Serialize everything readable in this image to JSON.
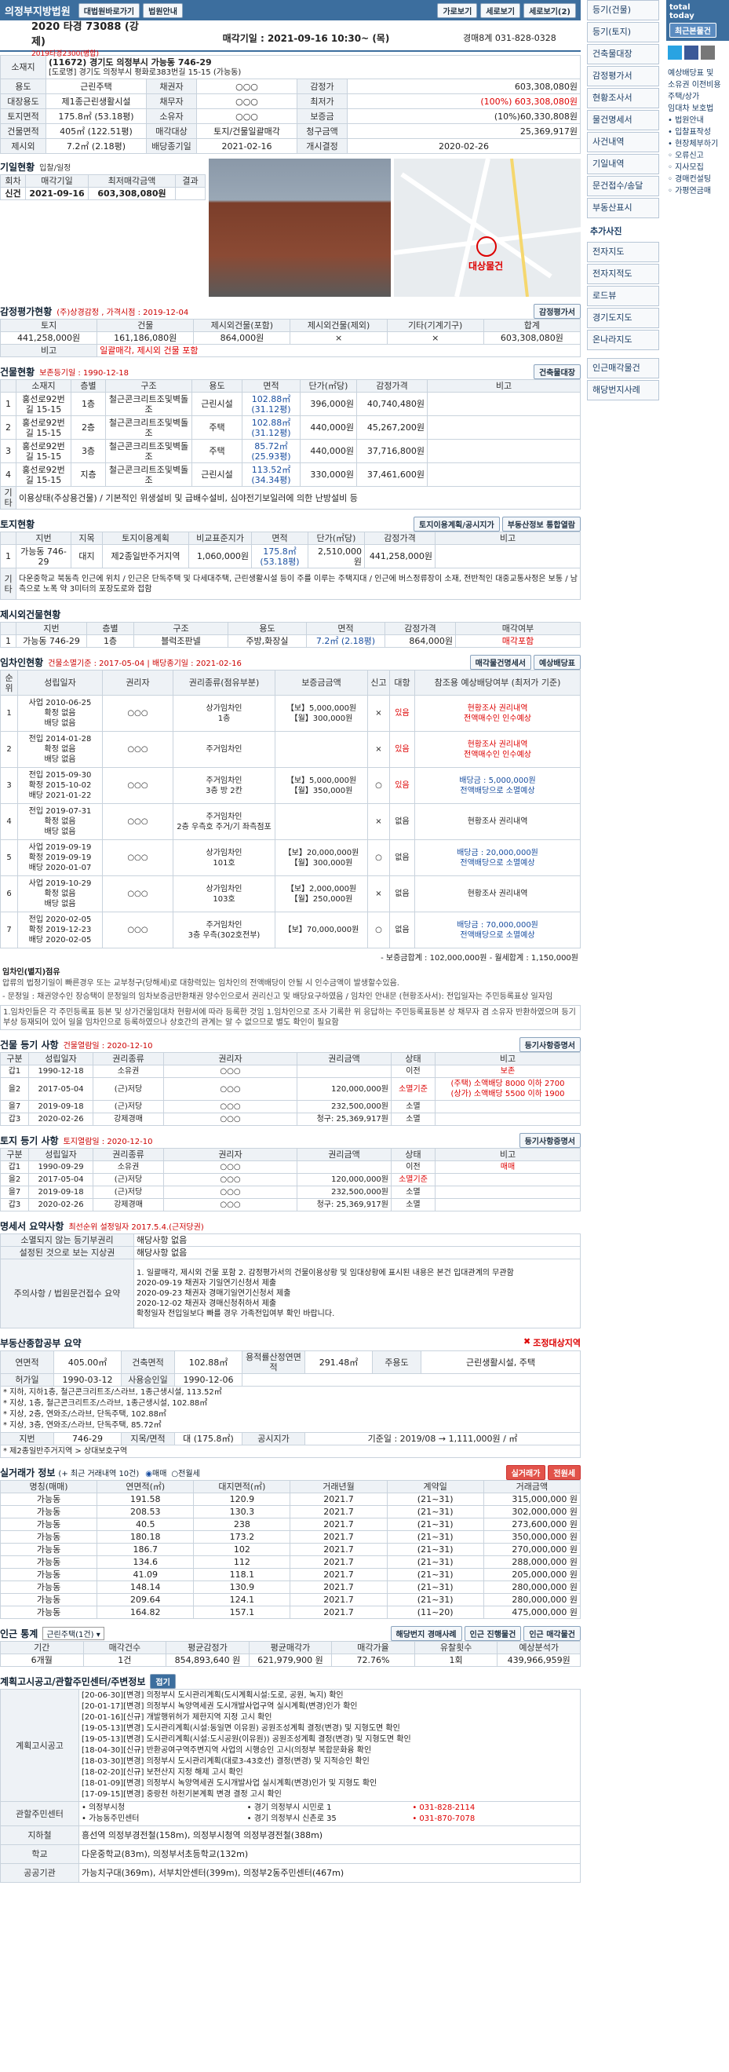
{
  "court": {
    "name": "의정부지방법원",
    "court_btn1": "대법원바로가기",
    "court_btn2": "법원안내"
  },
  "topbtns": [
    "가로보기",
    "세로보기",
    "세로보기(2)"
  ],
  "case": {
    "no": "2020 타경 73088 (강제)",
    "sub": "2019타경2300(병합)",
    "sale_date_label": "매각기일 : 2021-09-16 10:30~ (목)",
    "team": "경매8계 031-828-0328"
  },
  "info": {
    "addr_label": "소재지",
    "addr": "(11672) 경기도 의정부시 가능동 746-29",
    "addr2": "[도로명]  경기도 의정부시 평화로383번길 15-15 (가능동)",
    "rows": [
      [
        "용도",
        "근린주택",
        "채권자",
        "○○○",
        "감정가",
        "603,308,080원"
      ],
      [
        "대장용도",
        "제1종근린생활시설",
        "채무자",
        "○○○",
        "최저가",
        "(100%) 603,308,080원"
      ],
      [
        "토지면적",
        "175.8㎡ (53.18평)",
        "소유자",
        "○○○",
        "보증금",
        "(10%)60,330,808원"
      ],
      [
        "건물면적",
        "405㎡ (122.51평)",
        "매각대상",
        "토지/건물일괄매각",
        "청구금액",
        "25,369,917원"
      ],
      [
        "제시외",
        "7.2㎡ (2.18평)",
        "배당종기일",
        "2021-02-16",
        "개시결정",
        "2020-02-26"
      ]
    ]
  },
  "history": {
    "title": "기일현황",
    "sub": "입찰/일정",
    "h": [
      "회차",
      "매각기일",
      "최저매각금액",
      "결과"
    ],
    "rows": [
      [
        "신건",
        "2021-09-16",
        "603,308,080원",
        ""
      ]
    ]
  },
  "map": {
    "label": "대상물건"
  },
  "appraisal": {
    "title": "감정평가현황",
    "sub": "(주)상경감정 , 가격시점 : 2019-12-04",
    "btn": "감정평가서",
    "h": [
      "토지",
      "건물",
      "제시외건물(포함)",
      "제시외건물(제외)",
      "기타(기계기구)",
      "합계"
    ],
    "row": [
      "441,258,000원",
      "161,186,080원",
      "864,000원",
      "×",
      "×",
      "603,308,080원"
    ],
    "note_label": "비고",
    "note": "일괄매각, 제시외 건물 포함"
  },
  "building": {
    "title": "건물현황",
    "sub": "보존등기일 : 1990-12-18",
    "btn": "건축물대장",
    "h": [
      "소재지",
      "층별",
      "구조",
      "용도",
      "면적",
      "단가(㎡당)",
      "감정가격",
      "비고"
    ],
    "rows": [
      [
        "1",
        "홍선로92번길 15-15",
        "1층",
        "철근콘크리트조및벽돌조",
        "근린시설",
        "102.88㎡ (31.12평)",
        "396,000원",
        "40,740,480원",
        ""
      ],
      [
        "2",
        "홍선로92번길 15-15",
        "2층",
        "철근콘크리트조및벽돌조",
        "주택",
        "102.88㎡ (31.12평)",
        "440,000원",
        "45,267,200원",
        ""
      ],
      [
        "3",
        "홍선로92번길 15-15",
        "3층",
        "철근콘크리트조및벽돌조",
        "주택",
        "85.72㎡ (25.93평)",
        "440,000원",
        "37,716,800원",
        ""
      ],
      [
        "4",
        "홍선로92번길 15-15",
        "지층",
        "철근콘크리트조및벽돌조",
        "근린시설",
        "113.52㎡ (34.34평)",
        "330,000원",
        "37,461,600원",
        ""
      ]
    ],
    "etc_label": "기타",
    "etc": "이용상태(주상용건물) / 기본적인 위생설비 및 급배수설비, 심야전기보일러에 의한 난방설비 등"
  },
  "land": {
    "title": "토지현황",
    "btn1": "토지이용계획/공시지가",
    "btn2": "부동산정보 통합열람",
    "h": [
      "지번",
      "지목",
      "토지이용계획",
      "비교표준지가",
      "면적",
      "단가(㎡당)",
      "감정가격",
      "비고"
    ],
    "row": [
      "1",
      "가능동 746-29",
      "대지",
      "제2종일반주거지역",
      "1,060,000원",
      "175.8㎡ (53.18평)",
      "2,510,000원",
      "441,258,000원",
      ""
    ],
    "etc_label": "기타",
    "etc": "다운중학교 북동측 인근에 위치 / 인근은 단독주택 및 다세대주택, 근린생활시설 등이 주를 이루는 주택지대 / 인근에 버스정류장이 소재, 전반적인 대중교통사정은 보통 / 남측으로 노폭 약 3미터의 포장도로와 접함"
  },
  "extra": {
    "title": "제시외건물현황",
    "h": [
      "지번",
      "층별",
      "구조",
      "용도",
      "면적",
      "감정가격",
      "매각여부"
    ],
    "row": [
      "1",
      "가능동 746-29",
      "1층",
      "블럭조판넬",
      "주방,화장실",
      "7.2㎡ (2.18평)",
      "864,000원",
      "매각포함"
    ]
  },
  "lease": {
    "title": "임차인현황",
    "sub": "건물소멸기준 : 2017-05-04 | 배당종기일 : 2021-02-16",
    "btn1": "매각물건명세서",
    "btn2": "예상배당표",
    "h": [
      "순위",
      "성립일자",
      "권리자",
      "권리종류(점유부분)",
      "보증금금액",
      "신고",
      "대항",
      "참조용 예상배당여부 (최저가 기준)"
    ],
    "rows": [
      [
        "1",
        "사업 2010-06-25\n확정 없음\n배당 없음",
        "○○○",
        "상가임차인\n1층",
        "【보】5,000,000원\n【월】300,000원",
        "×",
        "있음",
        "현황조사 권리내역\n전액매수인 인수예상"
      ],
      [
        "2",
        "전입 2014-01-28\n확정 없음\n배당 없음",
        "○○○",
        "주거임차인",
        "",
        "×",
        "있음",
        "현황조사 권리내역\n전액매수인 인수예상"
      ],
      [
        "3",
        "전입 2015-09-30\n확정 2015-10-02\n배당 2021-01-22",
        "○○○",
        "주거임차인\n3층 방 2칸",
        "【보】5,000,000원\n【월】350,000원",
        "○",
        "있음",
        "배당금 : 5,000,000원\n전액배당으로 소멸예상"
      ],
      [
        "4",
        "전입 2019-07-31\n확정 없음\n배당 없음",
        "○○○",
        "주거임차인\n2층 우측호 주거/기 좌측점포",
        "",
        "×",
        "없음",
        "현황조사 권리내역"
      ],
      [
        "5",
        "사업 2019-09-19\n확정 2019-09-19\n배당 2020-01-07",
        "○○○",
        "상가임차인\n101호",
        "【보】20,000,000원\n【월】300,000원",
        "○",
        "없음",
        "배당금 : 20,000,000원\n전액배당으로 소멸예상"
      ],
      [
        "6",
        "사업 2019-10-29\n확정 없음\n배당 없음",
        "○○○",
        "상가임차인\n103호",
        "【보】2,000,000원\n【월】250,000원",
        "×",
        "없음",
        "현황조사 권리내역"
      ],
      [
        "7",
        "전입 2020-02-05\n확정 2019-12-23\n배당 2020-02-05",
        "○○○",
        "주거임차인\n3층 우측(302호전부)",
        "【보】70,000,000원",
        "○",
        "없음",
        "배당금 : 70,000,000원\n전액배당으로 소멸예상"
      ]
    ],
    "sum": "- 보증금합계 : 102,000,000원 - 월세합계 : 1,150,000원",
    "flag": "임차인(별지)점유",
    "note1": "압류의 법정기일이 빠른경우 또는 교부청구(당해세)로 대항력있는 임차인의 전액배당이 안될 시 인수금액이 발생할수있음.",
    "note2": "- 문정일 : 채권양수인 장승택이 문정일의 임차보증금반환채권 양수인으로서 권리신고 및 배당요구하였음 / 임차인 안내문 (현황조사서): 전입일자는 주민등록표상 일자임",
    "note3": "1.임차인들은 각 주민등록표 등본 및 상가건물임대차 현황서에 따라 등록한 것임 1.임차인으로 조사 기록한 위 응답하는 주민등록표등본 상 채무자 겸 소유자 반환하였으며 등기부상 등재되어 있어 일을 임차인으로 등록하였으나 상호간의 관계는 알 수 없으므로 별도 확인이 필요함"
  },
  "breg": {
    "title": "건물 등기 사항",
    "sub": "건물열람일 : 2020-12-10",
    "btn": "등기사항증명서",
    "h": [
      "구분",
      "성립일자",
      "권리종류",
      "권리자",
      "권리금액",
      "상태",
      "비고"
    ],
    "rows": [
      [
        "갑1",
        "1990-12-18",
        "소유권",
        "○○○",
        "",
        "이전",
        "보존"
      ],
      [
        "을2",
        "2017-05-04",
        "(근)저당",
        "○○○",
        "120,000,000원",
        "소멸기준",
        "(주택) 소액배당 8000 이하 2700\n(상가) 소액배당 5500 이하 1900"
      ],
      [
        "을7",
        "2019-09-18",
        "(근)저당",
        "○○○",
        "232,500,000원",
        "소멸",
        ""
      ],
      [
        "갑3",
        "2020-02-26",
        "강제경매",
        "○○○",
        "청구: 25,369,917원",
        "소멸",
        ""
      ]
    ]
  },
  "lreg": {
    "title": "토지 등기 사항",
    "sub": "토지열람일 : 2020-12-10",
    "btn": "등기사항증명서",
    "h": [
      "구분",
      "성립일자",
      "권리종류",
      "권리자",
      "권리금액",
      "상태",
      "비고"
    ],
    "rows": [
      [
        "갑1",
        "1990-09-29",
        "소유권",
        "○○○",
        "",
        "이전",
        "매매"
      ],
      [
        "을2",
        "2017-05-04",
        "(근)저당",
        "○○○",
        "120,000,000원",
        "소멸기준",
        ""
      ],
      [
        "을7",
        "2019-09-18",
        "(근)저당",
        "○○○",
        "232,500,000원",
        "소멸",
        ""
      ],
      [
        "갑3",
        "2020-02-26",
        "강제경매",
        "○○○",
        "청구: 25,369,917원",
        "소멸",
        ""
      ]
    ]
  },
  "summary": {
    "title": "명세서 요약사항",
    "sub": "최선순위 설정일자 2017.5.4.(근저당권)",
    "rows": [
      [
        "소멸되지 않는 등기부권리",
        "해당사항 없음"
      ],
      [
        "설정된 것으로 보는 지상권",
        "해당사항 없음"
      ],
      [
        "주의사항 / 법원문건접수 요약",
        "1. 일괄매각, 제시외 건물 포함 2. 감정평가서의 건물이용상황 및 임대상황에 표시된 내용은 본건 입대관계의 무관함\n2020-09-19 채권자 기일연기신청서 제출\n2020-09-23 채권자 경매기일연기신청서 제출\n2020-12-02 채권자 경매신청취하서 제출\n확정일자 전입일보다 빠를 경우 가족전입여부 확인 바랍니다."
      ]
    ]
  },
  "unified": {
    "title": "부동산종합공부 요약",
    "right": "조정대상지역",
    "r1": [
      "연면적",
      "405.00㎡",
      "건축면적",
      "102.88㎡",
      "용적률산정연면적",
      "291.48㎡",
      "주용도",
      "근린생활시설, 주택"
    ],
    "r2": [
      "허가일",
      "1990-03-12",
      "사용승인일",
      "1990-12-06"
    ],
    "notes": [
      "* 지하, 지하1층, 철근콘크리트조/스라브, 1종근생시설, 113.52㎡",
      "* 지상, 1층, 철근콘크리트조/스라브, 1종근생시설, 102.88㎡",
      "* 지상, 2층, 연와조/스라브, 단독주택, 102.88㎡",
      "* 지상, 3층, 연와조/스라브, 단독주택, 85.72㎡"
    ],
    "r3": [
      "지번",
      "746-29",
      "지목/면적",
      "대 (175.8㎡)",
      "공시지가",
      "기준일 : 2019/08 → 1,111,000원 / ㎡"
    ],
    "foot": "* 제2종일반주거지역 > 상대보호구역"
  },
  "trade": {
    "title": "실거래가 정보",
    "sub": "(+ 최근 거래내역 10건)",
    "opt1": "매매",
    "opt2": "전월세",
    "btn1": "실거래가",
    "btn2": "전원세",
    "h": [
      "명칭(매매)",
      "연면적(㎡)",
      "대지면적(㎡)",
      "거래년월",
      "계약일",
      "거래금액"
    ],
    "rows": [
      [
        "가능동",
        "191.58",
        "120.9",
        "2021.7",
        "(21~31)",
        "315,000,000 원"
      ],
      [
        "가능동",
        "208.53",
        "130.3",
        "2021.7",
        "(21~31)",
        "302,000,000 원"
      ],
      [
        "가능동",
        "40.5",
        "238",
        "2021.7",
        "(21~31)",
        "273,600,000 원"
      ],
      [
        "가능동",
        "180.18",
        "173.2",
        "2021.7",
        "(21~31)",
        "350,000,000 원"
      ],
      [
        "가능동",
        "186.7",
        "102",
        "2021.7",
        "(21~31)",
        "270,000,000 원"
      ],
      [
        "가능동",
        "134.6",
        "112",
        "2021.7",
        "(21~31)",
        "288,000,000 원"
      ],
      [
        "가능동",
        "41.09",
        "118.1",
        "2021.7",
        "(21~31)",
        "205,000,000 원"
      ],
      [
        "가능동",
        "148.14",
        "130.9",
        "2021.7",
        "(21~31)",
        "280,000,000 원"
      ],
      [
        "가능동",
        "209.64",
        "124.1",
        "2021.7",
        "(21~31)",
        "280,000,000 원"
      ],
      [
        "가능동",
        "164.82",
        "157.1",
        "2021.7",
        "(11~20)",
        "475,000,000 원"
      ]
    ]
  },
  "nearby": {
    "title": "인근 통계",
    "select": "근린주택(1건)",
    "btn1": "해당번지 경매사례",
    "btn2": "인근 진행물건",
    "btn3": "인근 매각물건",
    "h": [
      "기간",
      "매각건수",
      "평균감정가",
      "평균매각가",
      "매각가율",
      "유찰횟수",
      "예상분석가"
    ],
    "row": [
      "6개월",
      "1건",
      "854,893,640 원",
      "621,979,900 원",
      "72.76%",
      "1회",
      "439,966,959원"
    ]
  },
  "plan": {
    "title": "계획고시공고/관할주민센터/주변정보",
    "tag": "접기",
    "rows_label": "계획고시공고",
    "items": [
      "[20-06-30][변경] 의정부시 도시관리계획(도시계획시설:도로, 공원, 녹지) 확인",
      "[20-01-17][변경] 의정부시 녹양역세권 도시개발사업구역 실시계획(변경)인가 확인",
      "[20-01-16][신규] 개발행위허가 제한지역 지정 고시 확인",
      "[19-05-13][변경] 도시관리계획(시설:동일면 이유원) 공원조성계획 결정(변경) 및 지형도면 확인",
      "[19-05-13][변경] 도시관리계획(시설:도시공원(이유원)) 공원조성계획 결정(변경) 및 지형도면 확인",
      "[18-04-30][신규] 반환공여구역주변지역 사업의 시행승인 고시(의정부 복합문화융 확인",
      "[18-03-30][변경] 의정부시 도시관리계획(대로3-43호선) 결정(변경) 및 지적승인 확인",
      "[18-02-20][신규] 보전산지 지정 해제 고시 확인",
      "[18-01-09][변경] 의정부시 녹양역세권 도시개발사업 실시계획(변경)인가 및 지형도 확인",
      "[17-09-15][변경] 중랑천 하천기본계획 변경 결정 고시 확인"
    ],
    "office_label": "관할주민센터",
    "office": [
      "• 의정부시청",
      "• 경기 의정부시 시민로 1",
      "• 031-828-2114",
      "• 가능동주민센터",
      "• 경기 의정부시 신촌로 35",
      "• 031-870-7078"
    ],
    "subway_label": "지하철",
    "subway": "흥선역 의정부경전철(158m), 의정부시청역 의정부경전철(388m)",
    "school_label": "학교",
    "school": "다운중학교(83m), 의정부서초등학교(132m)",
    "public_label": "공공기관",
    "public": "가능치구대(369m), 서부치안센터(399m), 의정부2동주민센터(467m)"
  },
  "side": {
    "items": [
      "등기(건물)",
      "등기(토지)",
      "건축물대장",
      "감정평가서",
      "현황조사서",
      "물건명세서",
      "사건내역",
      "기일내역",
      "문건접수/송달",
      "부동산표시"
    ],
    "head2": "추가사진",
    "items2": [
      "전자지도",
      "전자지적도",
      "로드뷰",
      "경기도지도",
      "온나라지도"
    ],
    "head3": "인근진행물건",
    "items3": [
      "인근매각물건",
      "해당번지사례"
    ]
  },
  "rside": {
    "top1": "total",
    "top2": "today",
    "btn": "최근본물건",
    "links": [
      "예상배당표 및",
      "소유권 이전비용",
      "주택/상가",
      "임대차 보호법",
      "• 법원안내",
      "• 입찰표작성",
      "• 현장체부하기",
      "◦ 오류신고",
      "◦ 지사모집",
      "◦ 경매컨설팅",
      "◦ 가평연금매"
    ]
  },
  "colors": {
    "header": "#3c6e9e",
    "accent": "#d00000"
  }
}
